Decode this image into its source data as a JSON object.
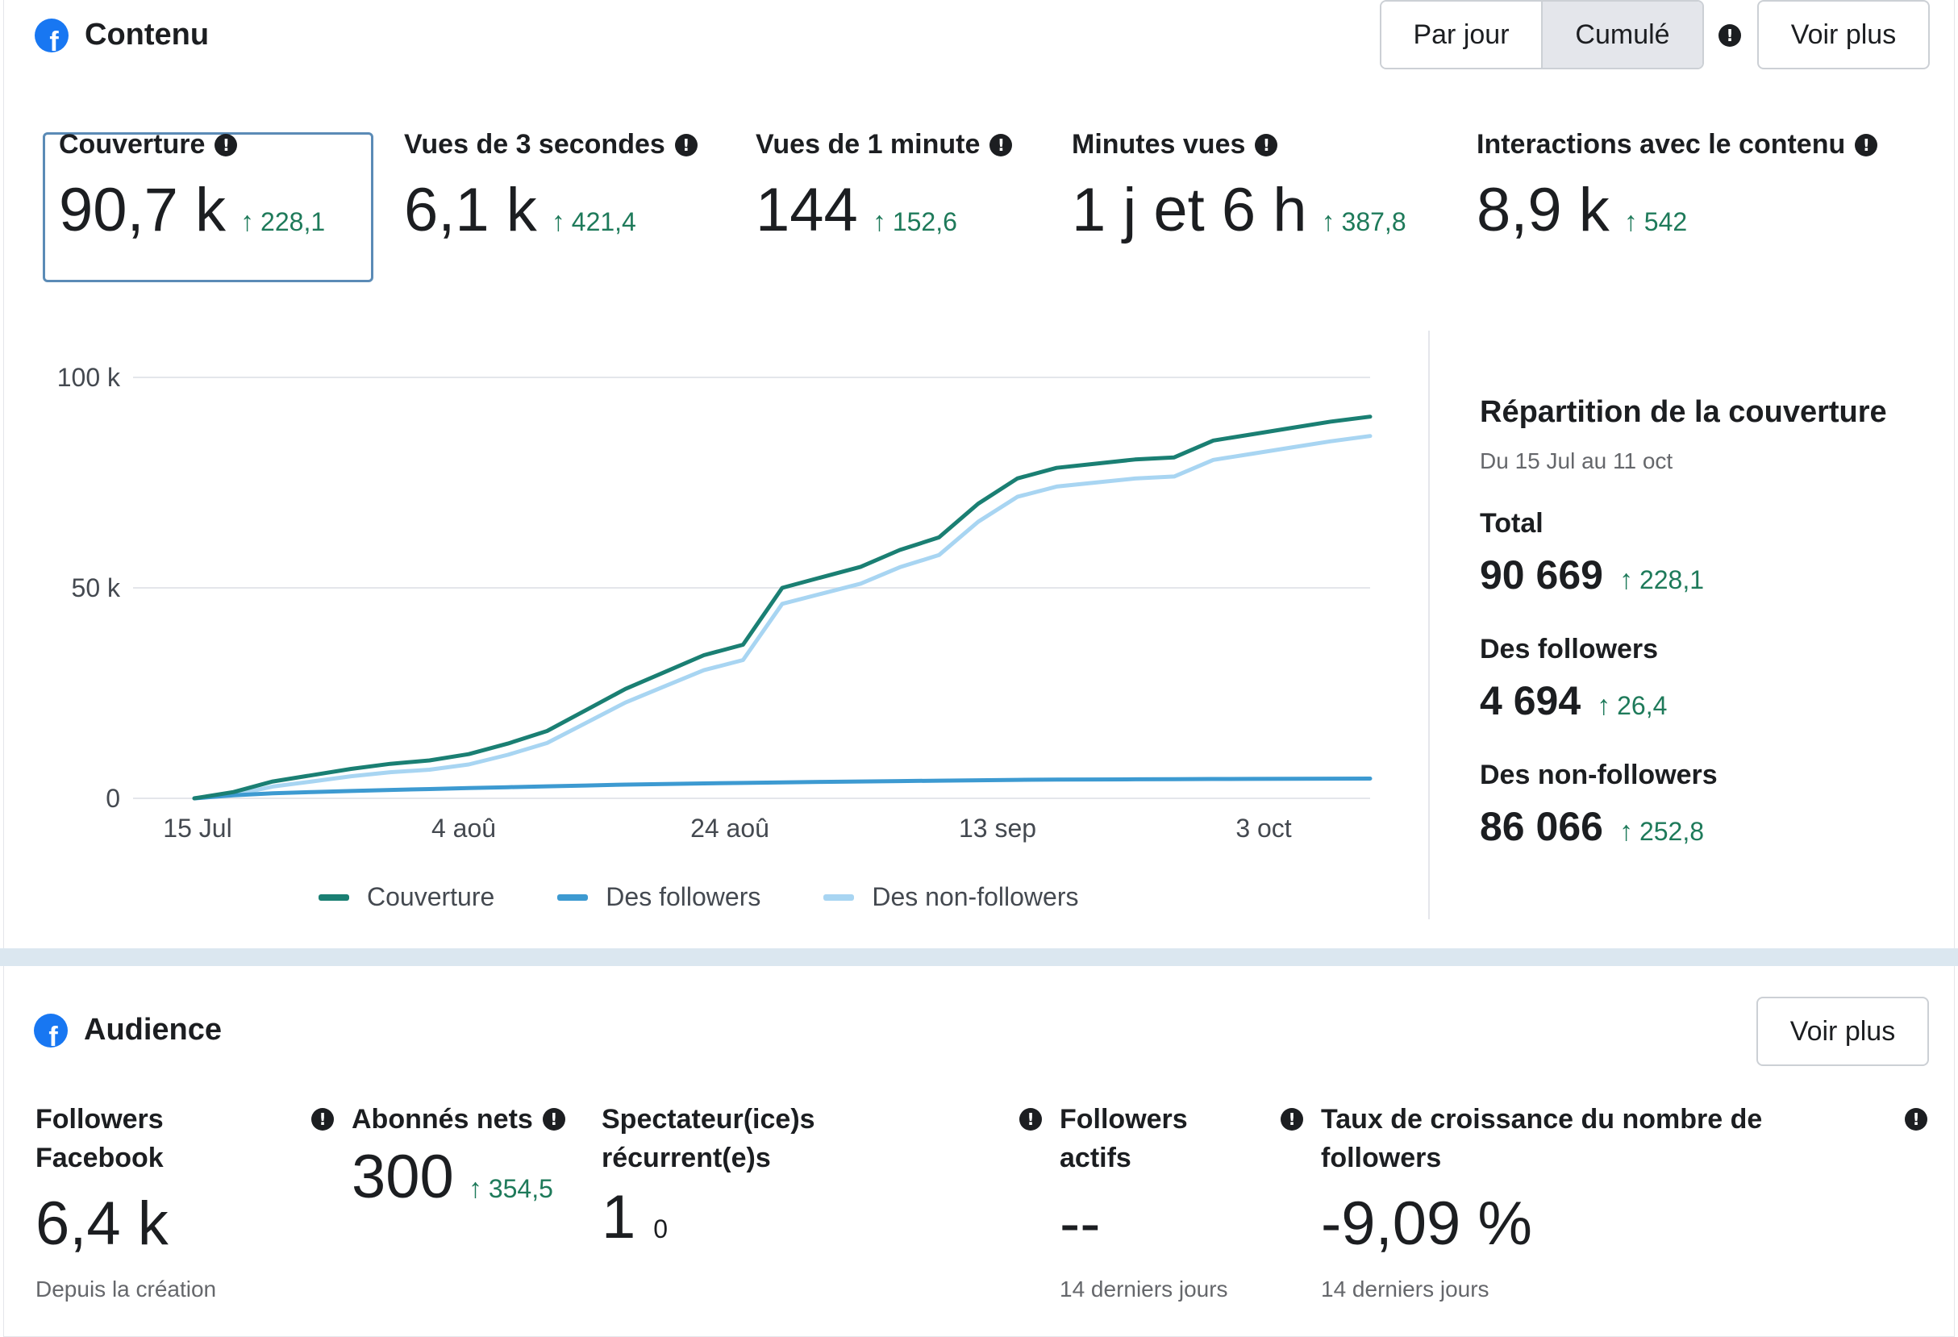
{
  "contenu": {
    "title": "Contenu",
    "toggle": {
      "daily": "Par jour",
      "cumulative": "Cumulé",
      "selected": "Cumulé"
    },
    "voir_plus": "Voir plus",
    "metrics": [
      {
        "label": "Couverture",
        "value": "90,7 k",
        "change": "228,1",
        "selected": true
      },
      {
        "label": "Vues de 3 secondes",
        "value": "6,1 k",
        "change": "421,4"
      },
      {
        "label": "Vues de 1 minute",
        "value": "144",
        "change": "152,6"
      },
      {
        "label": "Minutes vues",
        "value": "1 j et 6 h",
        "change": "387,8"
      },
      {
        "label": "Interactions avec le contenu",
        "value": "8,9 k",
        "change": "542"
      }
    ]
  },
  "chart_data": {
    "type": "line",
    "title": "",
    "xlabel": "",
    "ylabel": "",
    "x_tick_labels": [
      "15 Jul",
      "4 aoû",
      "24 aoû",
      "13 sep",
      "3 oct"
    ],
    "y_tick_labels": [
      "0",
      "50 k",
      "100 k"
    ],
    "ylim": [
      0,
      100000
    ],
    "grid": true,
    "legend_position": "bottom",
    "x": [
      "15 Jul",
      "18 Jul",
      "21 Jul",
      "24 Jul",
      "27 Jul",
      "30 Jul",
      "2 aoû",
      "5 aoû",
      "8 aoû",
      "11 aoû",
      "14 aoû",
      "17 aoû",
      "20 aoû",
      "23 aoû",
      "25 aoû",
      "28 aoû",
      "31 aoû",
      "3 sep",
      "6 sep",
      "9 sep",
      "12 sep",
      "15 sep",
      "18 sep",
      "21 sep",
      "24 sep",
      "25 sep",
      "28 sep",
      "1 oct",
      "4 oct",
      "7 oct",
      "11 oct"
    ],
    "series": [
      {
        "name": "Couverture",
        "color": "#1a7f73",
        "values": [
          0,
          1500,
          4000,
          5500,
          7000,
          8200,
          9000,
          10500,
          13000,
          16000,
          21000,
          26000,
          30000,
          34000,
          36500,
          50000,
          52500,
          55000,
          59000,
          62000,
          70000,
          76000,
          78500,
          79500,
          80500,
          81000,
          85000,
          86500,
          88000,
          89500,
          90669
        ]
      },
      {
        "name": "Des followers",
        "color": "#3d9ad1",
        "values": [
          0,
          700,
          1200,
          1500,
          1750,
          2000,
          2200,
          2450,
          2650,
          2850,
          3050,
          3250,
          3400,
          3550,
          3650,
          3800,
          3900,
          4000,
          4100,
          4200,
          4300,
          4380,
          4440,
          4490,
          4530,
          4550,
          4590,
          4620,
          4650,
          4670,
          4694
        ]
      },
      {
        "name": "Des non-followers",
        "color": "#a8d5f2",
        "values": [
          0,
          800,
          2800,
          4000,
          5250,
          6200,
          6800,
          8050,
          10350,
          13150,
          17950,
          22750,
          26600,
          30450,
          32850,
          46200,
          48600,
          51000,
          54900,
          57800,
          65700,
          71620,
          74060,
          75010,
          75970,
          76450,
          80410,
          81880,
          83350,
          84830,
          86066
        ]
      }
    ]
  },
  "repartition": {
    "title": "Répartition de la couverture",
    "period": "Du 15 Jul au 11 oct",
    "total": {
      "label": "Total",
      "value": "90 669",
      "change": "228,1"
    },
    "followers": {
      "label": "Des followers",
      "value": "4 694",
      "change": "26,4"
    },
    "non_followers": {
      "label": "Des non-followers",
      "value": "86 066",
      "change": "252,8"
    }
  },
  "audience": {
    "title": "Audience",
    "voir_plus": "Voir plus",
    "followers_facebook": {
      "label_line1": "Followers",
      "label_line2": "Facebook",
      "value": "6,4 k",
      "sub": "Depuis la création"
    },
    "abonnes_nets": {
      "label": "Abonnés nets",
      "value": "300",
      "change": "354,5"
    },
    "spectateurs": {
      "label_line1": "Spectateur(ice)s",
      "label_line2": "récurrent(e)s",
      "value": "1",
      "sub_value": "0"
    },
    "followers_actifs": {
      "label_line1": "Followers",
      "label_line2": "actifs",
      "value": "--",
      "sub": "14 derniers jours"
    },
    "taux": {
      "label_line1": "Taux de croissance du nombre de",
      "label_line2": "followers",
      "value": "-9,09 %",
      "sub": "14 derniers jours"
    }
  },
  "icons": {
    "info": "!",
    "arrow_up": "↑",
    "facebook": "f"
  }
}
